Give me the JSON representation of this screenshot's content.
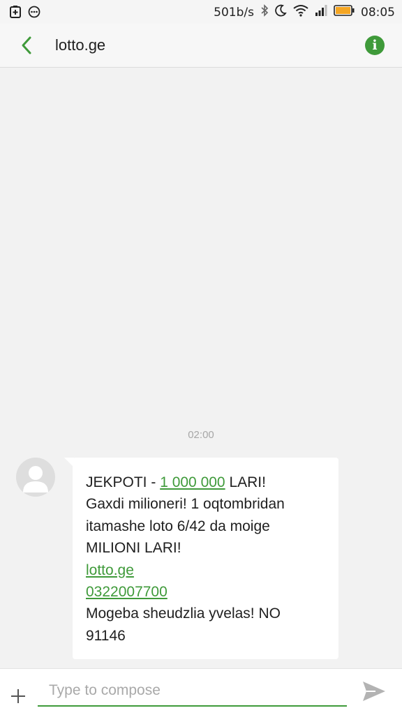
{
  "status_bar": {
    "left_icons": [
      "battery-saver-icon",
      "message-notification-icon"
    ],
    "network_speed": "501b/s",
    "right_icons": [
      "bluetooth-icon",
      "moon-icon",
      "wifi-icon",
      "signal-icon",
      "battery-icon"
    ],
    "battery_color": "#f5a623",
    "time": "08:05"
  },
  "app_bar": {
    "back_icon": "chevron-left-icon",
    "title": "lotto.ge",
    "info_icon": "info-icon",
    "info_glyph": "i",
    "accent": "#3f9a3a"
  },
  "conversation": {
    "timestamp": "02:00",
    "message": {
      "line1_prefix": "JEKPOTI - ",
      "line1_link": "1 000 000",
      "line1_suffix": " LARI!",
      "line2": "Gaxdi milioneri! 1 oqtombridan",
      "line3": "itamashe loto 6/42 da moige",
      "line4": "MILIONI LARI!",
      "link_site": "lotto.ge",
      "link_phone": "0322007700",
      "line7": "Mogeba sheudzlia yvelas! NO",
      "line8": "91146"
    }
  },
  "compose": {
    "add_icon": "plus-icon",
    "placeholder": "Type to compose",
    "value": "",
    "send_icon": "send-icon"
  }
}
